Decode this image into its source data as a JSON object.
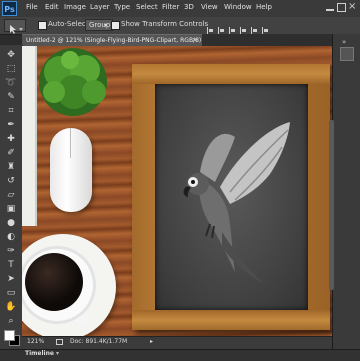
{
  "menu": {
    "items": [
      "File",
      "Edit",
      "Image",
      "Layer",
      "Type",
      "Select",
      "Filter",
      "3D",
      "View",
      "Window",
      "Help"
    ],
    "logo": "Ps"
  },
  "options": {
    "auto_select_label": "Auto-Select:",
    "auto_select_value": "Group",
    "show_transform_label": "Show Transform Controls"
  },
  "document": {
    "tab_title": "Untitled-2 @ 121% (Single-Flying-Bird-PNG-Clipart, RGB/8) *",
    "tab_close": "×"
  },
  "status": {
    "zoom": "121%",
    "doc_size": "Doc: 891.4K/1.77M",
    "arrow": "▸"
  },
  "timeline": {
    "label": "Timeline"
  },
  "window_controls": {
    "close": "×"
  },
  "tools": [
    "move-icon",
    "marquee-icon",
    "lasso-icon",
    "quick-select-icon",
    "crop-icon",
    "eyedropper-icon",
    "healing-icon",
    "brush-icon",
    "clone-stamp-icon",
    "history-brush-icon",
    "eraser-icon",
    "gradient-icon",
    "blur-icon",
    "dodge-icon",
    "pen-icon",
    "type-icon",
    "path-select-icon",
    "shape-icon",
    "hand-icon",
    "zoom-icon"
  ],
  "colors": {
    "foreground": "#ffffff",
    "background": "#000000"
  }
}
